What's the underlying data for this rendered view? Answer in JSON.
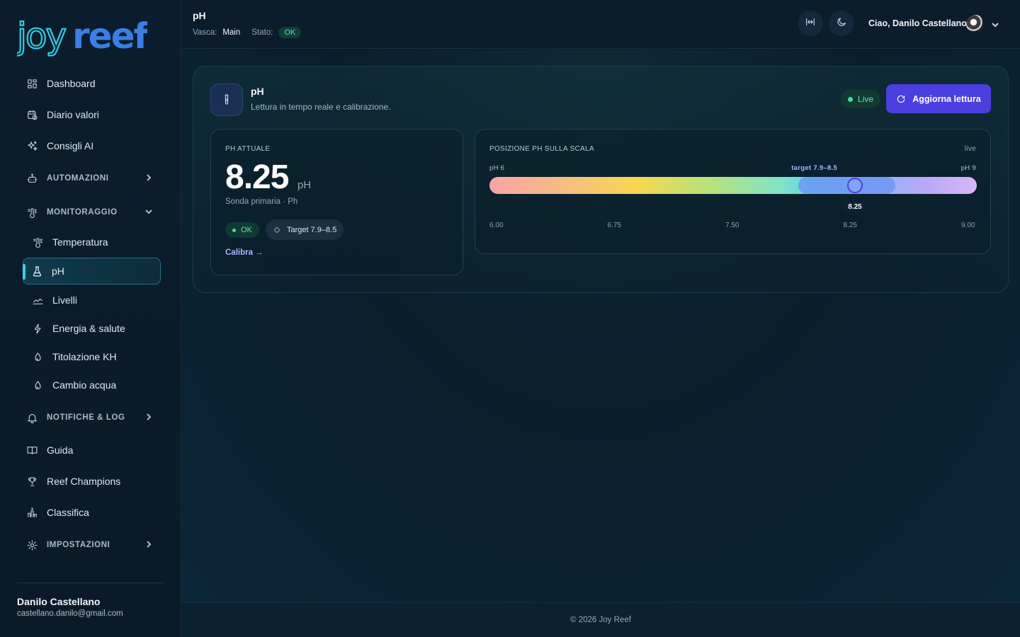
{
  "app": {
    "logo_text": "joyreef"
  },
  "sidebar": {
    "items": [
      {
        "label": "Dashboard",
        "icon": "dashboard-icon"
      },
      {
        "label": "Diario valori",
        "icon": "calendar-clock-icon"
      },
      {
        "label": "Consigli AI",
        "icon": "sparkles-icon"
      },
      {
        "label": "AUTOMAZIONI",
        "icon": "robot-icon",
        "group": true,
        "expanded": false
      },
      {
        "label": "MONITORAGGIO",
        "icon": "thermometer-icon",
        "group": true,
        "expanded": true
      },
      {
        "label": "Temperatura",
        "icon": "thermometer-icon"
      },
      {
        "label": "pH",
        "icon": "flask-icon",
        "active": true
      },
      {
        "label": "Livelli",
        "icon": "waves-icon"
      },
      {
        "label": "Energia & salute",
        "icon": "bolt-icon"
      },
      {
        "label": "Titolazione KH",
        "icon": "drop-icon"
      },
      {
        "label": "Cambio acqua",
        "icon": "drop-icon"
      },
      {
        "label": "NOTIFICHE & LOG",
        "icon": "bell-icon",
        "group": true,
        "expanded": false
      },
      {
        "label": "Guida",
        "icon": "book-icon"
      },
      {
        "label": "Reef Champions",
        "icon": "trophy-icon"
      },
      {
        "label": "Classifica",
        "icon": "leaderboard-icon"
      },
      {
        "label": "IMPOSTAZIONI",
        "icon": "gear-icon",
        "group": true,
        "expanded": false
      }
    ],
    "user": {
      "name": "Danilo Castellano",
      "email": "castellano.danilo@gmail.com"
    }
  },
  "header": {
    "title": "pH",
    "tank_label": "Vasca:",
    "tank_value": "Main",
    "status_label": "Stato:",
    "status_value": "OK",
    "greeting": "Ciao, Danilo Castellano"
  },
  "card": {
    "title": "pH",
    "subtitle": "Lettura in tempo reale e calibrazione.",
    "live_label": "Live",
    "refresh_label": "Aggiorna lettura"
  },
  "current": {
    "label": "PH ATTUALE",
    "value": "8.25",
    "unit": "pH",
    "probe": "Sonda primaria · Ph",
    "status": "OK",
    "target": "Target 7.9–8.5",
    "calibrate": "Calibra →"
  },
  "scale": {
    "label": "POSIZIONE PH SULLA SCALA",
    "live": "live",
    "min_label": "pH 6",
    "max_label": "pH 9",
    "target_label": "target 7.9–8.5",
    "min": 6.0,
    "max": 9.0,
    "target_min": 7.9,
    "target_max": 8.5,
    "value": 8.25,
    "value_label": "8.25",
    "ticks": [
      "6.00",
      "6.75",
      "7.50",
      "8.25",
      "9.00"
    ]
  },
  "footer": {
    "text": "© 2026 Joy Reef"
  },
  "colors": {
    "accent": "#4b3fe0",
    "ok": "#3fe0a4",
    "active_bar": "#37d3e6"
  }
}
